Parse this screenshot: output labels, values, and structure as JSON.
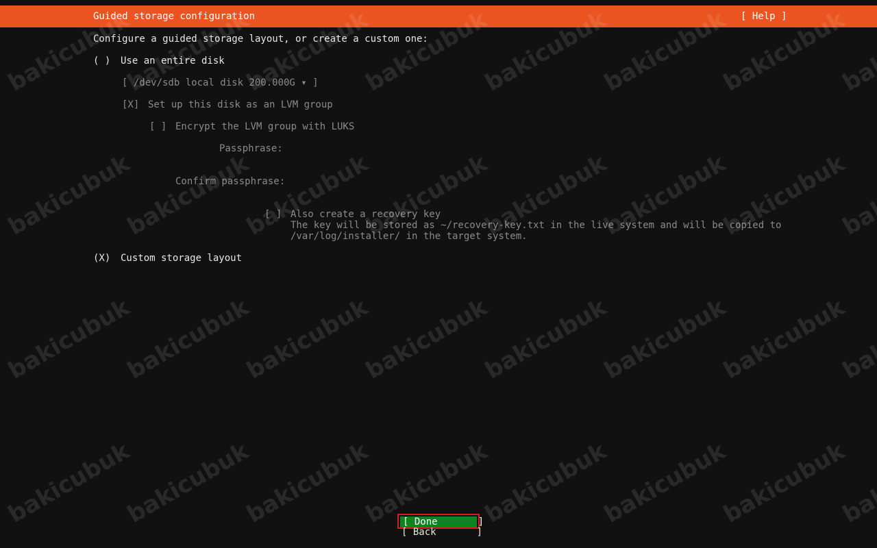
{
  "header": {
    "title": "Guided storage configuration",
    "help": "[ Help ]"
  },
  "intro": "Configure a guided storage layout, or create a custom one:",
  "options": {
    "entire_disk": {
      "radio": "( )",
      "label": "Use an entire disk",
      "disk_select": "[ /dev/sdb local disk 200.000G ▾ ]",
      "lvm_checkbox": "[X]",
      "lvm_label": "Set up this disk as an LVM group",
      "encrypt_checkbox": "[ ]",
      "encrypt_label": "Encrypt the LVM group with LUKS",
      "passphrase_label": "Passphrase:",
      "confirm_label": "Confirm passphrase:",
      "recovery_checkbox": "[ ]",
      "recovery_label": "Also create a recovery key",
      "recovery_desc_1": "The key will be stored as ~/recovery-key.txt in the live system and will be copied to",
      "recovery_desc_2": "/var/log/installer/ in the target system."
    },
    "custom": {
      "radio": "(X)",
      "label": "Custom storage layout"
    }
  },
  "buttons": {
    "done": "[ Done       ]",
    "back": "[ Back       ]"
  },
  "watermark": "bakicubuk",
  "colors": {
    "header_bg": "#e95420",
    "background": "#111111",
    "done_bg": "#0e8420",
    "highlight_border": "#d91c1c"
  }
}
